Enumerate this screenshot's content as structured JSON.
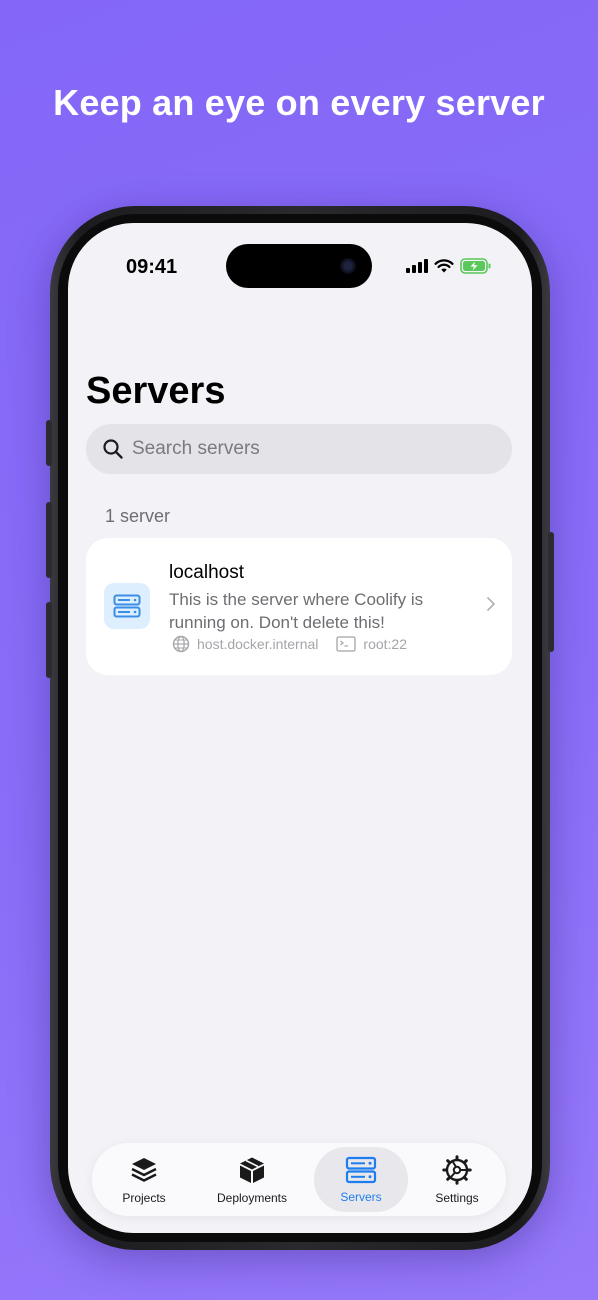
{
  "headline": "Keep an eye on every server",
  "status_bar": {
    "time": "09:41",
    "icons": [
      "cellular-signal-icon",
      "wifi-icon",
      "battery-charging-icon"
    ]
  },
  "page": {
    "title": "Servers"
  },
  "search": {
    "placeholder": "Search servers",
    "value": ""
  },
  "section": {
    "count_label": "1 server"
  },
  "servers": [
    {
      "name": "localhost",
      "description": "This is the server where Coolify is running on. Don't delete this!",
      "host": "host.docker.internal",
      "ssh": "root:22",
      "icon": "server-icon"
    }
  ],
  "tabbar": {
    "tabs": [
      {
        "label": "Projects",
        "icon": "layers-icon",
        "active": false
      },
      {
        "label": "Deployments",
        "icon": "box-icon",
        "active": false
      },
      {
        "label": "Servers",
        "icon": "server-icon",
        "active": true
      },
      {
        "label": "Settings",
        "icon": "gear-icon",
        "active": false
      }
    ]
  },
  "colors": {
    "background": "#8467f7",
    "accent": "#1e7ef0",
    "screen": "#f2f2f7",
    "battery_green": "#5ac85a"
  }
}
